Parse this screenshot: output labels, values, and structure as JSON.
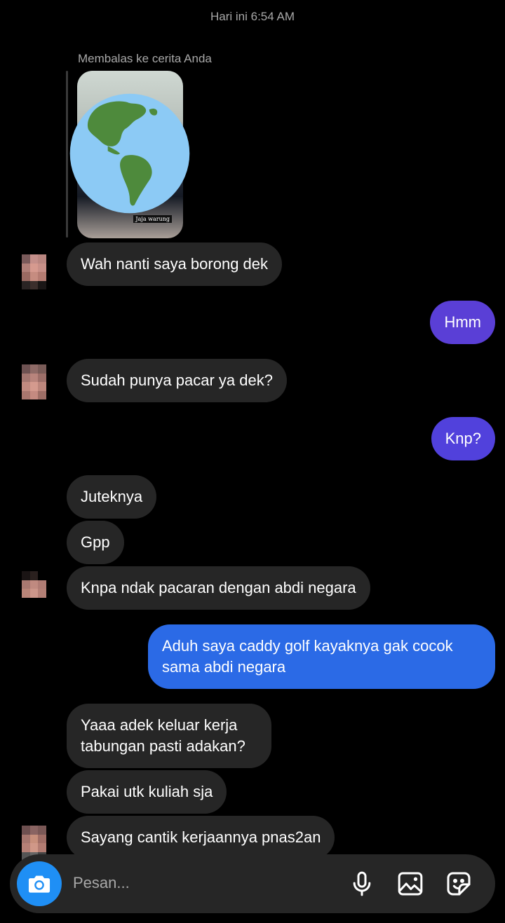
{
  "header": {
    "timestamp": "Hari ini 6:54 AM"
  },
  "story_reply": {
    "label": "Membalas ke cerita Anda",
    "story_caption": "Jaja warung"
  },
  "messages": [
    {
      "from": "them",
      "text": "Wah nanti saya borong dek"
    },
    {
      "from": "me",
      "text": "Hmm"
    },
    {
      "from": "them",
      "text": "Sudah punya pacar ya dek?"
    },
    {
      "from": "me",
      "text": "Knp?"
    },
    {
      "from": "them",
      "text": "Juteknya"
    },
    {
      "from": "them",
      "text": "Gpp"
    },
    {
      "from": "them",
      "text": "Knpa ndak pacaran dengan abdi negara"
    },
    {
      "from": "me",
      "text": "Aduh saya caddy golf kayaknya gak cocok sama abdi negara"
    },
    {
      "from": "them",
      "text": "Yaaa adek keluar kerja tabungan pasti adakan?"
    },
    {
      "from": "them",
      "text": "Pakai utk kuliah sja"
    },
    {
      "from": "them",
      "text": "Sayang cantik kerjaannya pnas2an"
    }
  ],
  "composer": {
    "placeholder": "Pesan..."
  },
  "icons": {
    "camera": "camera-icon",
    "mic": "microphone-icon",
    "gallery": "gallery-icon",
    "sticker": "sticker-icon",
    "globe": "globe-emoji"
  },
  "colors": {
    "background": "#000000",
    "incoming_bubble": "#262626",
    "outgoing_purple": "#5a3fd6",
    "outgoing_blue": "#2b6ae6",
    "camera_button": "#1f8ff5",
    "secondary_text": "#a8a8a8"
  }
}
